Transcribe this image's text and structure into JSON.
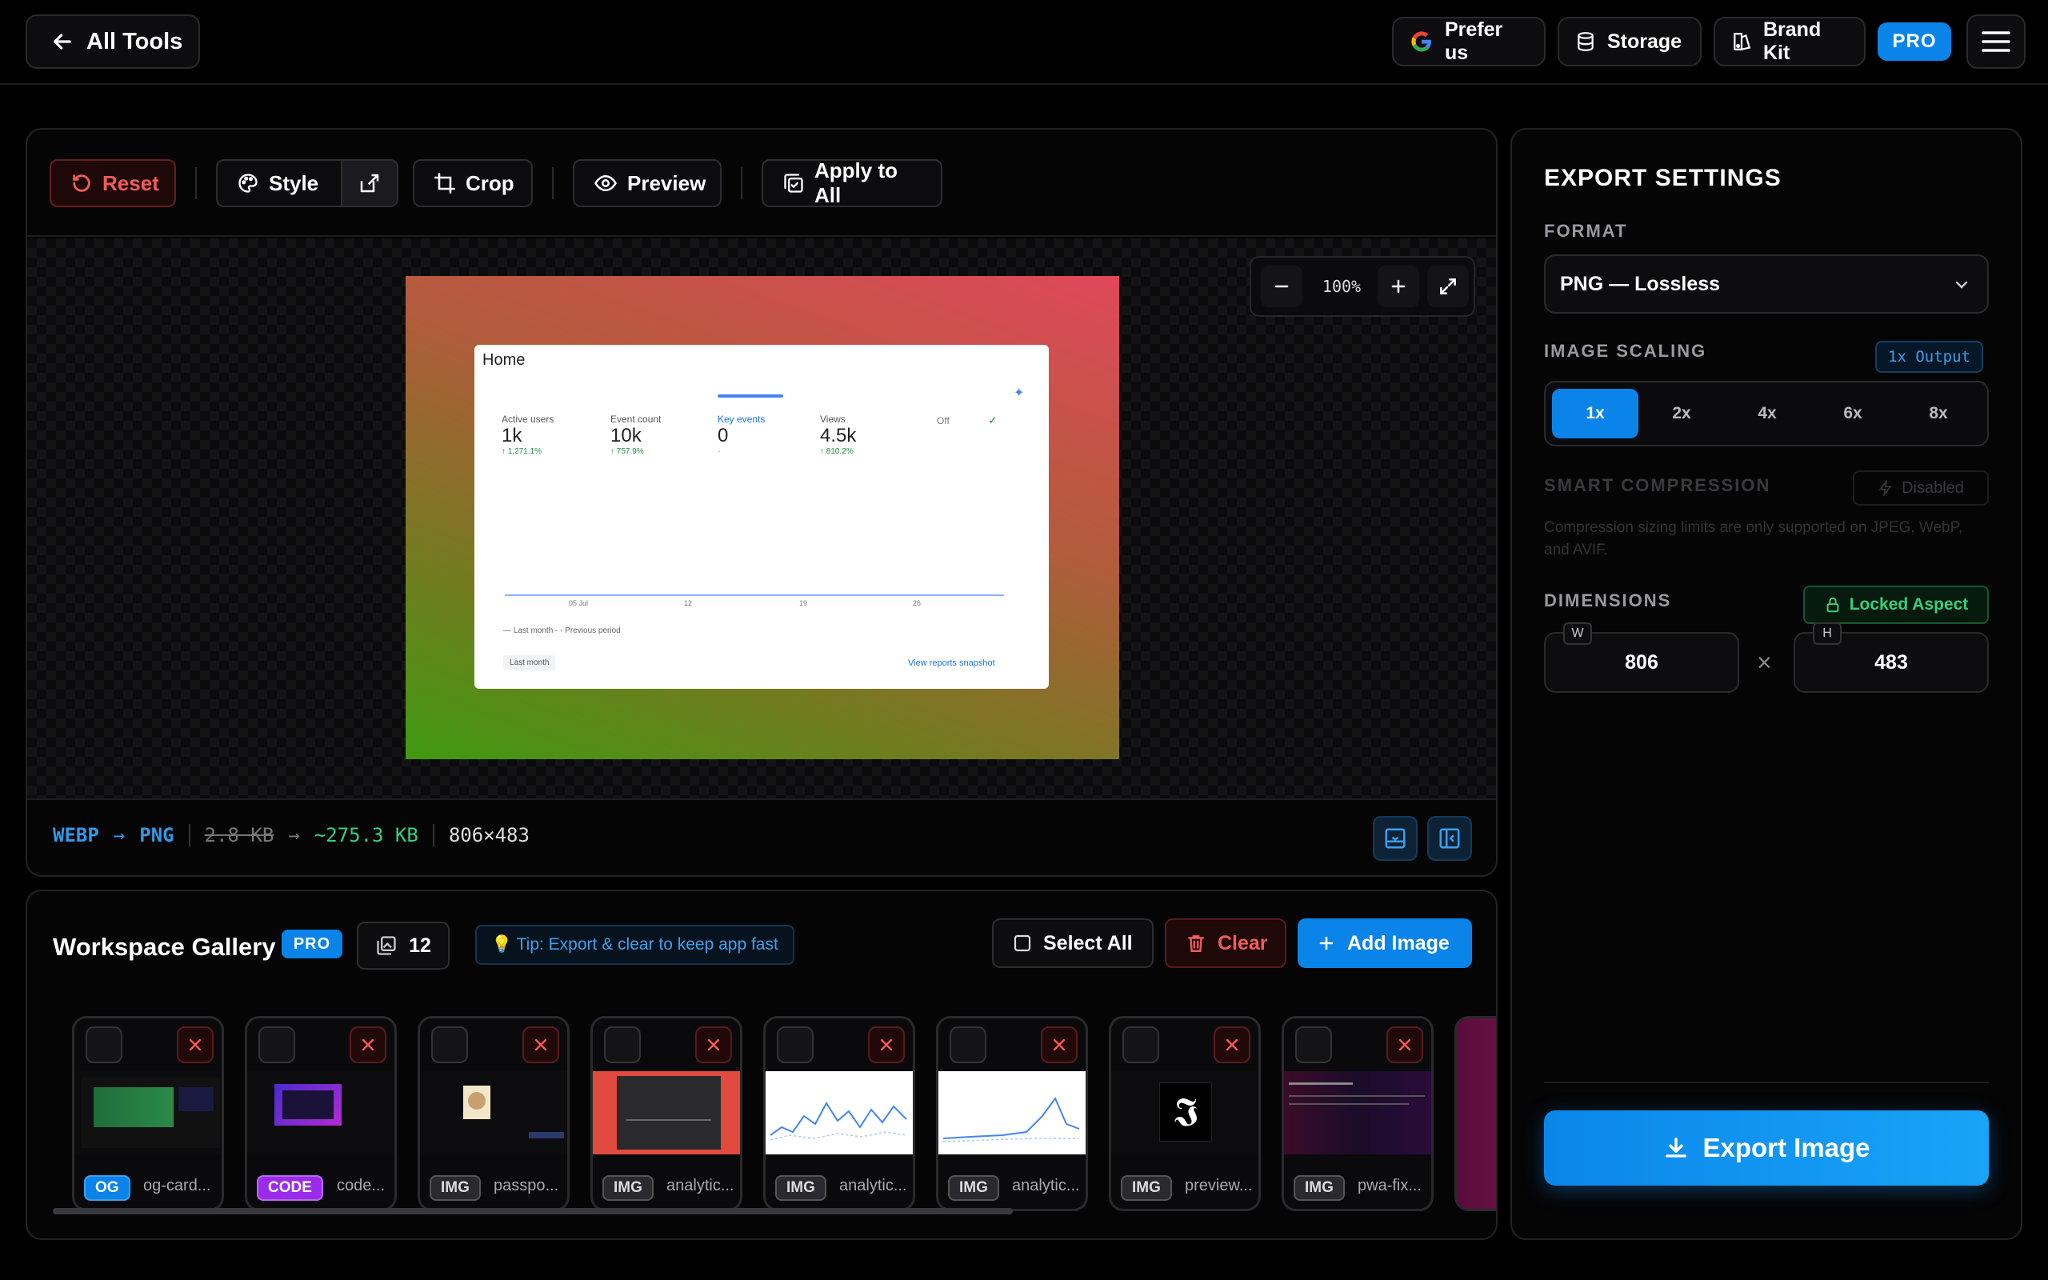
{
  "topbar": {
    "back_label": "All Tools",
    "prefer_us": "Prefer us",
    "storage": "Storage",
    "brand_kit": "Brand Kit",
    "pro": "PRO"
  },
  "toolbar": {
    "reset": "Reset",
    "style": "Style",
    "crop": "Crop",
    "preview": "Preview",
    "apply_all": "Apply to All"
  },
  "zoom": {
    "level": "100%"
  },
  "preview_image": {
    "title": "Home",
    "metrics": [
      {
        "label": "Active users",
        "value": "1k",
        "delta": "↑ 1,271.1%"
      },
      {
        "label": "Event count",
        "value": "10k",
        "delta": "↑ 757.9%"
      },
      {
        "label": "Key events",
        "value": "0",
        "delta": "-"
      },
      {
        "label": "Views",
        "value": "4.5k",
        "delta": "↑ 810.2%"
      }
    ],
    "toggle": "Off",
    "xticks": [
      "05 Jul",
      "12",
      "19",
      "26"
    ],
    "legend": "— Last month  - - Previous period",
    "range": "Last month",
    "link": "View reports snapshot"
  },
  "status": {
    "from_format": "WEBP",
    "to_format": "PNG",
    "orig_size": "2.8 KB",
    "new_size": "~275.3 KB",
    "dims": "806×483"
  },
  "gallery": {
    "title": "Workspace Gallery",
    "badge": "PRO",
    "count": "12",
    "tip": "💡 Tip: Export & clear to keep app fast",
    "select_all": "Select All",
    "clear": "Clear",
    "add": "Add Image",
    "items": [
      {
        "badge": "OG",
        "name": "og-card...",
        "style": "og"
      },
      {
        "badge": "CODE",
        "name": "code...",
        "style": "code"
      },
      {
        "badge": "IMG",
        "name": "passpo...",
        "style": "img"
      },
      {
        "badge": "IMG",
        "name": "analytic...",
        "style": "img"
      },
      {
        "badge": "IMG",
        "name": "analytic...",
        "style": "img"
      },
      {
        "badge": "IMG",
        "name": "analytic...",
        "style": "img"
      },
      {
        "badge": "IMG",
        "name": "preview...",
        "style": "img"
      },
      {
        "badge": "IMG",
        "name": "pwa-fix...",
        "style": "img"
      }
    ]
  },
  "export": {
    "title": "EXPORT SETTINGS",
    "format_label": "FORMAT",
    "format_value": "PNG — Lossless",
    "scaling_label": "IMAGE SCALING",
    "scaling_output": "1x Output",
    "scales": [
      "1x",
      "2x",
      "4x",
      "6x",
      "8x"
    ],
    "scale_selected": "1x",
    "compression_label": "SMART COMPRESSION",
    "compression_state": "Disabled",
    "compression_note": "Compression sizing limits are only supported on JPEG, WebP, and AVIF.",
    "dimensions_label": "DIMENSIONS",
    "locked": "Locked Aspect",
    "w_tag": "W",
    "h_tag": "H",
    "width": "806",
    "height": "483",
    "times": "×",
    "export_btn": "Export Image"
  },
  "colors": {
    "accent": "#0a84e8",
    "danger": "#f25b5b",
    "success": "#34d17a",
    "code_purple": "#9b2bea"
  }
}
